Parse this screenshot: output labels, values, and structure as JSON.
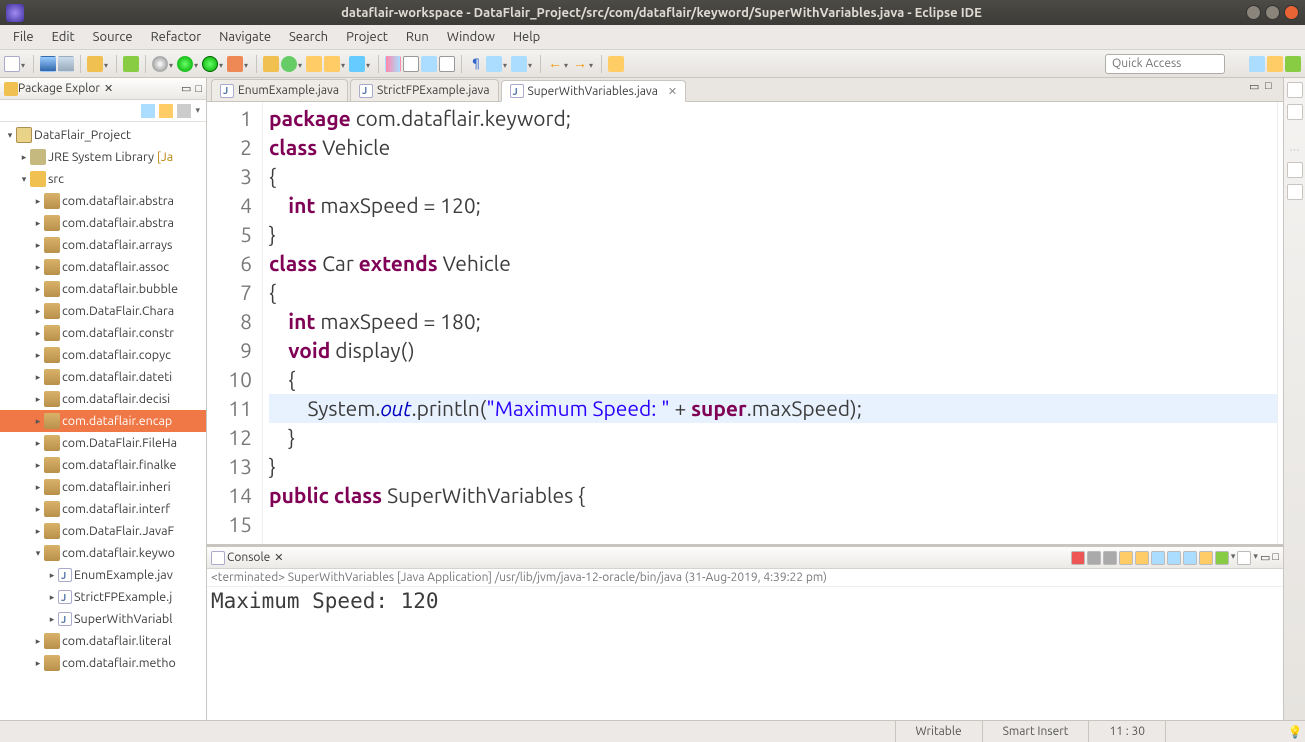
{
  "window": {
    "title": "dataflair-workspace - DataFlair_Project/src/com/dataflair/keyword/SuperWithVariables.java - Eclipse IDE"
  },
  "menu": [
    "File",
    "Edit",
    "Source",
    "Refactor",
    "Navigate",
    "Search",
    "Project",
    "Run",
    "Window",
    "Help"
  ],
  "quickAccess": "Quick Access",
  "packageExplorer": {
    "title": "Package Explor",
    "project": "DataFlair_Project",
    "jre": "JRE System Library [Ja",
    "src": "src",
    "packages": [
      "com.dataflair.abstra",
      "com.dataflair.abstra",
      "com.dataflair.arrays",
      "com.dataflair.assoc",
      "com.dataflair.bubble",
      "com.DataFlair.Chara",
      "com.dataflair.constr",
      "com.dataflair.copyc",
      "com.dataflair.dateti",
      "com.dataflair.decisi",
      "com.dataflair.encap",
      "com.DataFlair.FileHa",
      "com.dataflair.finalke",
      "com.dataflair.inheri",
      "com.dataflair.interf",
      "com.DataFlair.JavaF",
      "com.dataflair.keywo",
      "com.dataflair.literal",
      "com.dataflair.metho"
    ],
    "selectedIndex": 10,
    "expandedIndex": 16,
    "keywordFiles": [
      "EnumExample.jav",
      "StrictFPExample.j",
      "SuperWithVariabl"
    ]
  },
  "editorTabs": [
    {
      "label": "EnumExample.java",
      "active": false
    },
    {
      "label": "StrictFPExample.java",
      "active": false
    },
    {
      "label": "SuperWithVariables.java",
      "active": true
    }
  ],
  "code": {
    "lines": [
      [
        {
          "t": "package ",
          "c": "kw"
        },
        {
          "t": "com.dataflair.keyword;",
          "c": ""
        }
      ],
      [
        {
          "t": "class ",
          "c": "kw"
        },
        {
          "t": "Vehicle",
          "c": ""
        }
      ],
      [
        {
          "t": "{",
          "c": ""
        }
      ],
      [
        {
          "t": "    ",
          "c": ""
        },
        {
          "t": "int ",
          "c": "kw"
        },
        {
          "t": "maxSpeed = 120;",
          "c": ""
        }
      ],
      [
        {
          "t": "}",
          "c": ""
        }
      ],
      [
        {
          "t": "class ",
          "c": "kw"
        },
        {
          "t": "Car ",
          "c": ""
        },
        {
          "t": "extends ",
          "c": "kw"
        },
        {
          "t": "Vehicle",
          "c": ""
        }
      ],
      [
        {
          "t": "{",
          "c": ""
        }
      ],
      [
        {
          "t": "    ",
          "c": ""
        },
        {
          "t": "int ",
          "c": "kw"
        },
        {
          "t": "maxSpeed = 180;",
          "c": ""
        }
      ],
      [
        {
          "t": "    ",
          "c": ""
        },
        {
          "t": "void ",
          "c": "kw"
        },
        {
          "t": "display()",
          "c": ""
        }
      ],
      [
        {
          "t": "    {",
          "c": ""
        }
      ],
      [
        {
          "t": "        System.",
          "c": ""
        },
        {
          "t": "out",
          "c": "fld2"
        },
        {
          "t": ".println(",
          "c": ""
        },
        {
          "t": "\"Maximum Speed: \"",
          "c": "str"
        },
        {
          "t": " + ",
          "c": ""
        },
        {
          "t": "super",
          "c": "kw"
        },
        {
          "t": ".maxSpeed);",
          "c": ""
        }
      ],
      [
        {
          "t": "    }",
          "c": ""
        }
      ],
      [
        {
          "t": "}",
          "c": ""
        }
      ],
      [
        {
          "t": "public class ",
          "c": "kw"
        },
        {
          "t": "SuperWithVariables {",
          "c": ""
        }
      ],
      [
        {
          "t": "",
          "c": ""
        }
      ]
    ],
    "highlightLine": 11
  },
  "console": {
    "title": "Console",
    "info": "<terminated> SuperWithVariables [Java Application] /usr/lib/jvm/java-12-oracle/bin/java (31-Aug-2019, 4:39:22 pm)",
    "output": "Maximum Speed: 120"
  },
  "status": {
    "writable": "Writable",
    "insert": "Smart Insert",
    "pos": "11 : 30"
  }
}
